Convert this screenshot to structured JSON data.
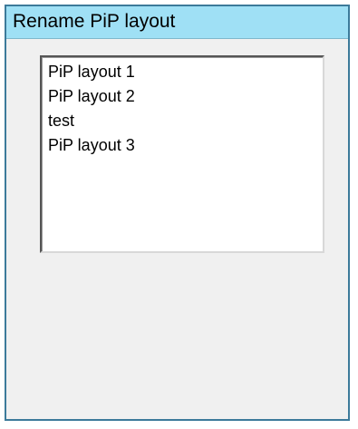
{
  "dialog": {
    "title": "Rename PiP layout"
  },
  "layout_list": {
    "items": [
      {
        "label": "PiP layout 1"
      },
      {
        "label": "PiP layout 2"
      },
      {
        "label": "test"
      },
      {
        "label": "PiP layout 3"
      }
    ]
  }
}
